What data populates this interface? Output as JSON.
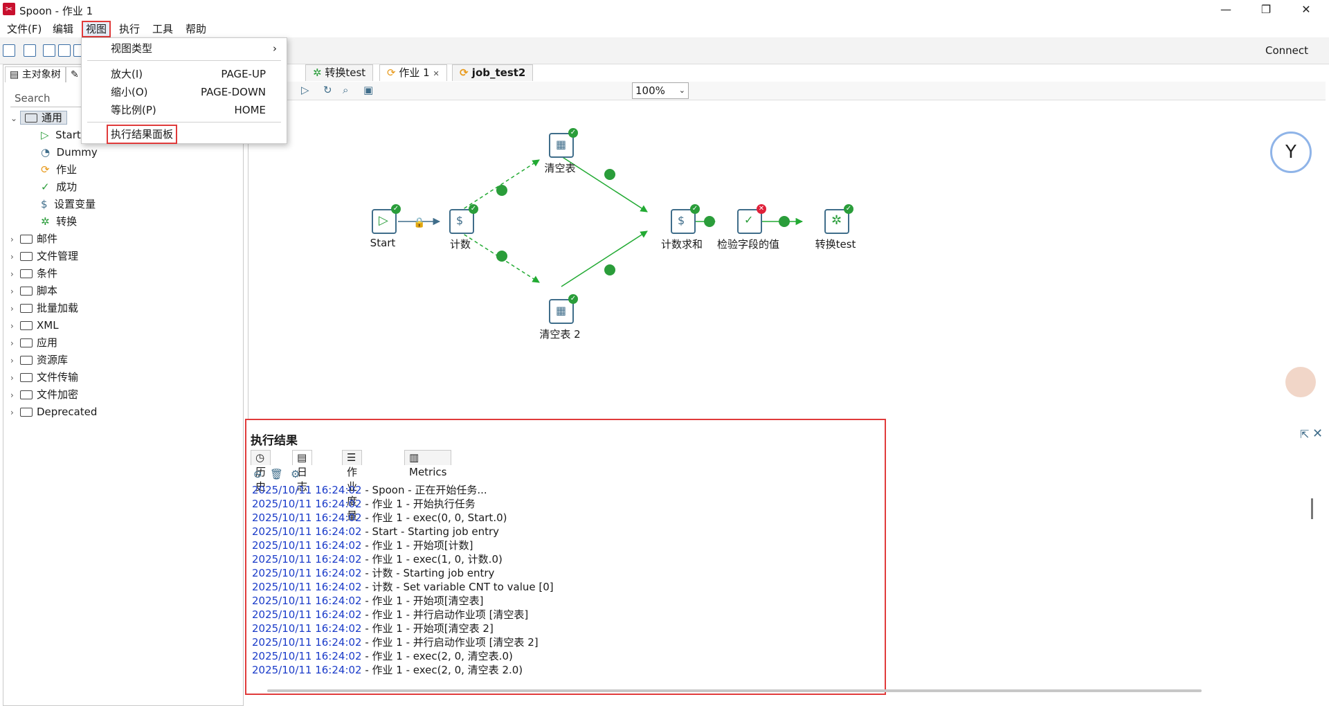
{
  "window": {
    "title": "Spoon - 作业 1",
    "connect_label": "Connect"
  },
  "menubar": {
    "items": [
      "文件(F)",
      "编辑",
      "视图",
      "执行",
      "工具",
      "帮助"
    ]
  },
  "view_menu": {
    "items": [
      {
        "label": "视图类型",
        "accel": ""
      },
      {
        "label": "放大(I)",
        "accel": "PAGE-UP"
      },
      {
        "label": "缩小(O)",
        "accel": "PAGE-DOWN"
      },
      {
        "label": "等比例(P)",
        "accel": "HOME"
      },
      {
        "label": "执行结果面板",
        "accel": ""
      }
    ]
  },
  "left_panel": {
    "tab_main": "主对象树",
    "search_placeholder": "Search",
    "tree": {
      "root": "通用",
      "children": [
        "Start",
        "Dummy",
        "作业",
        "成功",
        "设置变量",
        "转换"
      ],
      "folders": [
        "邮件",
        "文件管理",
        "条件",
        "脚本",
        "批量加载",
        "XML",
        "应用",
        "资源库",
        "文件传输",
        "文件加密",
        "Deprecated"
      ]
    }
  },
  "editor_tabs": [
    "转换test",
    "作业 1",
    "job_test2"
  ],
  "zoom": "100%",
  "graph": {
    "nodes": [
      "Start",
      "计数",
      "清空表",
      "清空表 2",
      "计数求和",
      "检验字段的值",
      "转换test"
    ]
  },
  "results": {
    "title": "执行结果",
    "tabs": [
      "历史",
      "日志",
      "作业度量",
      "Metrics"
    ],
    "log": [
      {
        "ts": "2025/10/11 16:24:02",
        "msg": " - Spoon - 正在开始任务..."
      },
      {
        "ts": "2025/10/11 16:24:02",
        "msg": " - 作业 1 - 开始执行任务"
      },
      {
        "ts": "2025/10/11 16:24:02",
        "msg": " - 作业 1 - exec(0, 0, Start.0)"
      },
      {
        "ts": "2025/10/11 16:24:02",
        "msg": " - Start - Starting job entry"
      },
      {
        "ts": "2025/10/11 16:24:02",
        "msg": " - 作业 1 - 开始项[计数]"
      },
      {
        "ts": "2025/10/11 16:24:02",
        "msg": " - 作业 1 - exec(1, 0, 计数.0)"
      },
      {
        "ts": "2025/10/11 16:24:02",
        "msg": " - 计数 - Starting job entry"
      },
      {
        "ts": "2025/10/11 16:24:02",
        "msg": " - 计数 - Set variable CNT to value [0]"
      },
      {
        "ts": "2025/10/11 16:24:02",
        "msg": " - 作业 1 - 开始项[清空表]"
      },
      {
        "ts": "2025/10/11 16:24:02",
        "msg": " - 作业 1 - 并行启动作业项 [清空表]"
      },
      {
        "ts": "2025/10/11 16:24:02",
        "msg": " - 作业 1 - 开始项[清空表 2]"
      },
      {
        "ts": "2025/10/11 16:24:02",
        "msg": " - 作业 1 - 并行启动作业项 [清空表 2]"
      },
      {
        "ts": "2025/10/11 16:24:02",
        "msg": " - 作业 1 - exec(2, 0, 清空表.0)"
      },
      {
        "ts": "2025/10/11 16:24:02",
        "msg": " - 作业 1 - exec(2, 0, 清空表 2.0)"
      }
    ]
  },
  "colors": {
    "highlight": "#e03a3a",
    "timestamp": "#1a3bc9",
    "ok": "#2a9d3a",
    "hop": "#22aa33"
  }
}
